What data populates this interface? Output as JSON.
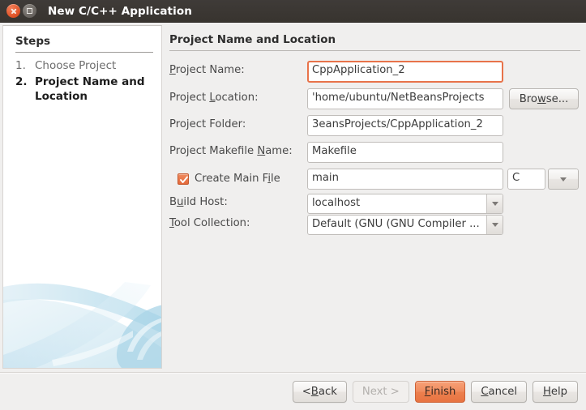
{
  "window": {
    "title": "New C/C++ Application",
    "close_icon": "close-icon",
    "maximize_icon": "maximize-icon"
  },
  "sidebar": {
    "heading": "Steps",
    "items": [
      {
        "number": "1.",
        "label": "Choose Project",
        "active": false
      },
      {
        "number": "2.",
        "label": "Project Name and Location",
        "active": true
      }
    ]
  },
  "content": {
    "heading": "Project Name and Location",
    "fields": [
      {
        "label_pre": "P",
        "label_mn": "",
        "label_post": "roject Name:",
        "mnemonic": "P",
        "value": "CppApplication_2",
        "focused": true
      },
      {
        "label": "Project Location:",
        "mnemonic": "L",
        "value": "'home/ubuntu/NetBeansProjects"
      },
      {
        "label": "Project Folder:",
        "mnemonic": "",
        "value": "3eansProjects/CppApplication_2"
      },
      {
        "label": "Project Makefile Name:",
        "mnemonic": "N",
        "value": "Makefile"
      }
    ],
    "labels": {
      "project_name_a": "P",
      "project_name_b": "roject Name:",
      "project_location_a": "Project ",
      "project_location_b": "L",
      "project_location_c": "ocation:",
      "project_folder": "Project Folder:",
      "project_makefile_a": "Project Makefile ",
      "project_makefile_b": "N",
      "project_makefile_c": "ame:",
      "build_host_a": "B",
      "build_host_b": "u",
      "build_host_c": "ild Host:",
      "tool_collection_a": "T",
      "tool_collection_b": "ool Collection:",
      "create_main_file_a": "Create Main F",
      "create_main_file_b": "i",
      "create_main_file_c": "le"
    },
    "values": {
      "project_name": "CppApplication_2",
      "project_location": "'home/ubuntu/NetBeansProjects",
      "project_folder": "3eansProjects/CppApplication_2",
      "project_makefile_name": "Makefile",
      "main_file_name": "main",
      "main_file_language": "C",
      "build_host": "localhost",
      "tool_collection": "Default (GNU (GNU Compiler ..."
    },
    "browse_button": {
      "pre": "Bro",
      "mn": "w",
      "post": "se..."
    },
    "create_main_file_checked": true
  },
  "buttons": [
    {
      "name": "back",
      "pre": "< ",
      "mn": "B",
      "post": "ack",
      "state": "normal"
    },
    {
      "name": "next",
      "pre": "Next >",
      "mn": "",
      "post": "",
      "state": "disabled"
    },
    {
      "name": "finish",
      "pre": "",
      "mn": "F",
      "post": "inish",
      "state": "primary"
    },
    {
      "name": "cancel",
      "pre": "",
      "mn": "C",
      "post": "ancel",
      "state": "normal"
    },
    {
      "name": "help",
      "pre": "",
      "mn": "H",
      "post": "elp",
      "state": "normal"
    }
  ],
  "button_labels": {
    "back_pre": "< ",
    "back_mn": "B",
    "back_post": "ack",
    "next": "Next >",
    "finish_mn": "F",
    "finish_post": "inish",
    "cancel_mn": "C",
    "cancel_post": "ancel",
    "help_mn": "H",
    "help_post": "elp"
  },
  "colors": {
    "titlebar": "#3b3733",
    "accent_orange": "#e8734a",
    "panel_bg": "#f0efee",
    "panel_white": "#ffffff",
    "swoosh_blue": "#bcdcea"
  }
}
